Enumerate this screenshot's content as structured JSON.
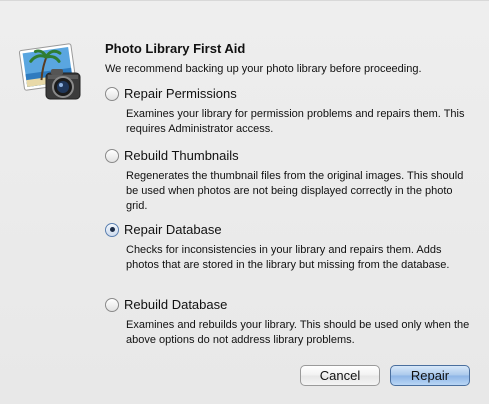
{
  "dialog": {
    "title": "Photo Library First Aid",
    "subtitle": "We recommend backing up your photo library before proceeding.",
    "icon": "iphoto-camera-icon"
  },
  "options": [
    {
      "label": "Repair Permissions",
      "description": "Examines your library for permission problems and repairs them. This requires Administrator access.",
      "selected": false
    },
    {
      "label": "Rebuild Thumbnails",
      "description": "Regenerates the thumbnail files from the original images. This should be used when photos are not being displayed correctly in the photo grid.",
      "selected": false
    },
    {
      "label": "Repair Database",
      "description": "Checks for inconsistencies in your library and repairs them. Adds photos that are stored in the library but missing from the database.",
      "selected": true
    },
    {
      "label": "Rebuild Database",
      "description": "Examines and rebuilds your library. This should be used only when the above options do not address library problems.",
      "selected": false
    }
  ],
  "buttons": {
    "cancel": "Cancel",
    "repair": "Repair"
  }
}
